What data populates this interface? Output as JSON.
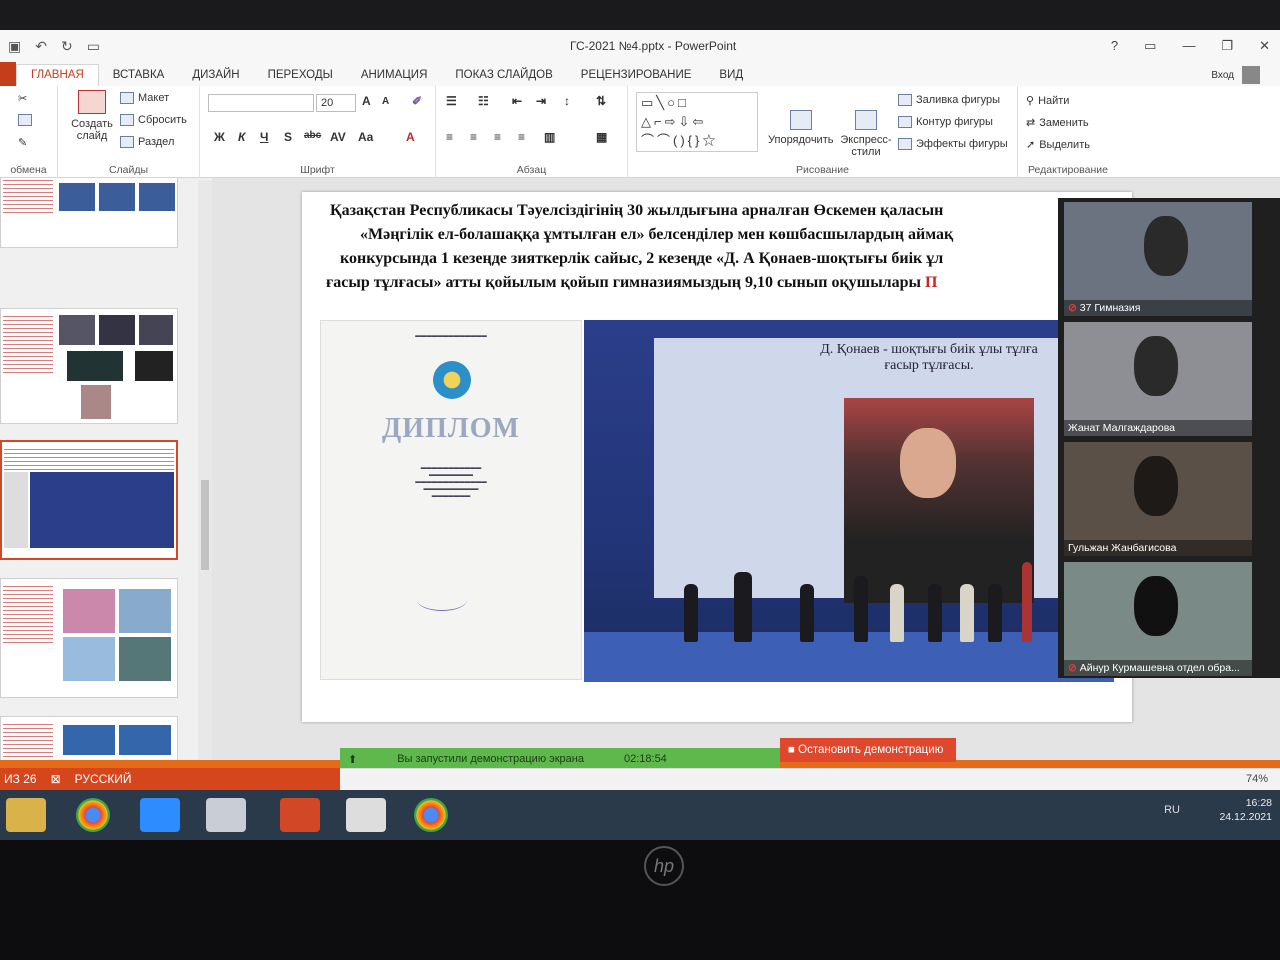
{
  "window": {
    "title": "ГС-2021 №4.pptx - PowerPoint"
  },
  "tabs": [
    "ГЛАВНАЯ",
    "ВСТАВКА",
    "ДИЗАЙН",
    "ПЕРЕХОДЫ",
    "АНИМАЦИЯ",
    "ПОКАЗ СЛАЙДОВ",
    "РЕЦЕНЗИРОВАНИЕ",
    "ВИД"
  ],
  "account": {
    "login": "Вход"
  },
  "ribbon": {
    "clipboard_label": "обмена",
    "slides": {
      "new_slide": "Создать слайд",
      "layout": "Макет",
      "reset": "Сбросить",
      "section": "Раздел",
      "label": "Слайды"
    },
    "font": {
      "size": "20",
      "label": "Шрифт"
    },
    "paragraph": {
      "label": "Абзац"
    },
    "drawing": {
      "arrange": "Упорядочить",
      "quick_styles": "Экспресс-стили",
      "fill": "Заливка фигуры",
      "outline": "Контур фигуры",
      "effects": "Эффекты фигуры",
      "label": "Рисование"
    },
    "editing": {
      "find": "Найти",
      "replace": "Заменить",
      "select": "Выделить",
      "label": "Редактирование"
    }
  },
  "slide": {
    "line1": "Қазақстан Республикасы Тәуелсіздігінің 30 жылдығына арналған Өскемен қаласын",
    "line2": "«Мәңгілік ел-болашаққа ұмтылған ел» белсенділер мен көшбасшылардың аймақ",
    "line3": "конкурсында 1 кезеңде зияткерлік сайыс, 2 кезеңде «Д. А Қонаев-шоқтығы биік ұл",
    "line4a": "ғасыр тұлғасы» атты қойылым қойып гимназиямыздың 9,10 сынып оқушылары",
    "line4b": "П",
    "diploma_title": "ДИПЛОМ",
    "photo_caption": "Д. Қонаев - шоқтығы биік ұлы тұлға ғасыр тұлғасы."
  },
  "call": {
    "participants": [
      {
        "name": "37 Гимназия"
      },
      {
        "name": "Жанат Малгаждарова"
      },
      {
        "name": "Гульжан Жанбагисова"
      },
      {
        "name": "Айнур Курмашевна отдел обра..."
      }
    ]
  },
  "status": {
    "slide_counter": "ИЗ 26",
    "language": "РУССКИЙ",
    "share_text": "Вы запустили демонстрацию экрана",
    "share_timer": "02:18:54",
    "stop_share": "Остановить демонстрацию",
    "zoom": "74%"
  },
  "taskbar": {
    "lang": "RU",
    "time": "16:28",
    "date": "24.12.2021"
  },
  "colors": {
    "accent": "#c43e1c",
    "share_green": "#5fb84c",
    "stop_red": "#e0482d"
  }
}
